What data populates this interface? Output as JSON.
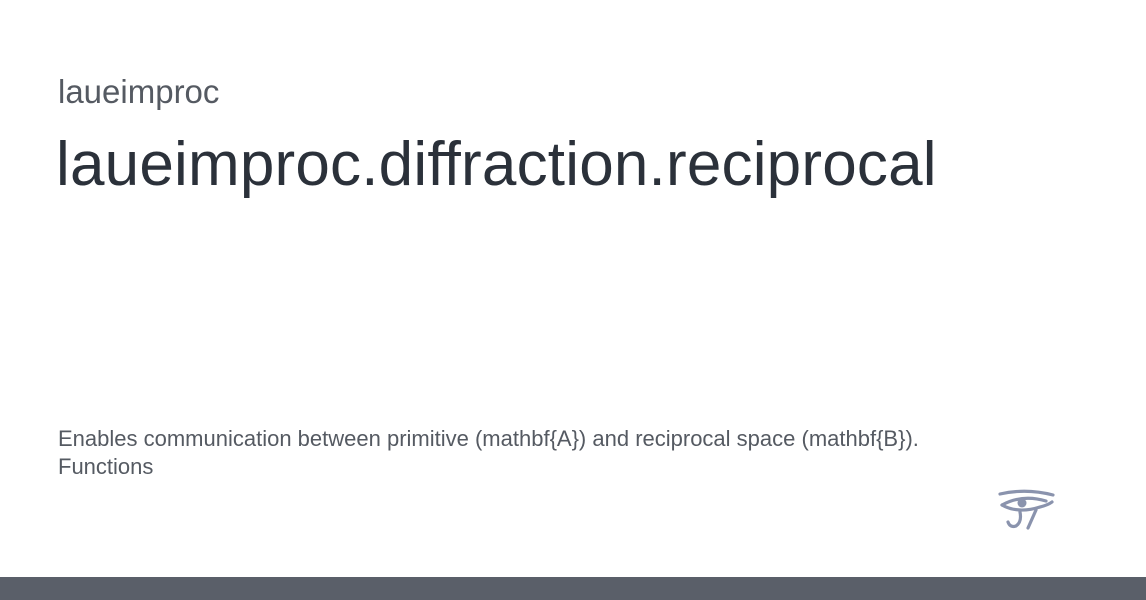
{
  "project": {
    "name": "laueimproc"
  },
  "page": {
    "title": "laueimproc.diffraction.reciprocal",
    "description_line1": "Enables communication between primitive (mathbf{A}) and reciprocal space (mathbf{B}).",
    "description_line2": "Functions"
  },
  "logo": {
    "icon": "eye-of-horus-icon",
    "color": "#8a93ad"
  },
  "footer": {
    "color": "#5a5f69"
  }
}
